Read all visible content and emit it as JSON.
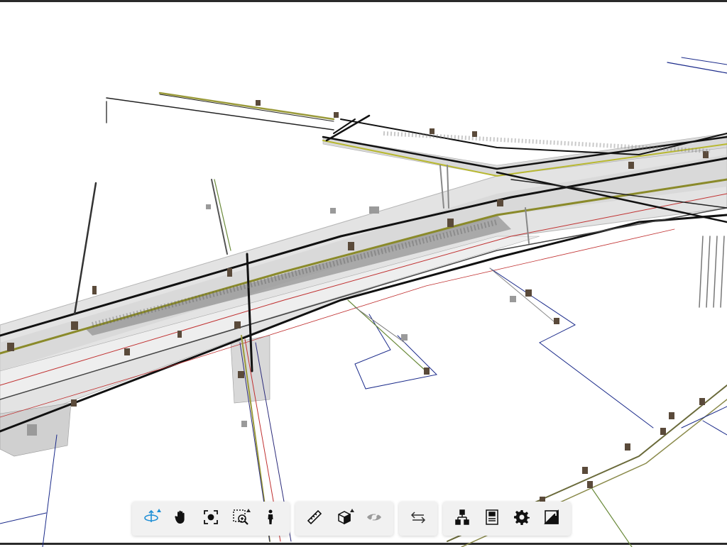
{
  "app": {
    "view": "3D model viewer",
    "accent_color": "#1f8fd6"
  },
  "toolbar": {
    "groups": [
      {
        "name": "navigation",
        "tools": [
          {
            "icon": "orbit-icon",
            "active": true,
            "has_submenu": true
          },
          {
            "icon": "pan-hand-icon",
            "active": false,
            "has_submenu": false
          },
          {
            "icon": "fit-to-view-icon",
            "active": false,
            "has_submenu": false
          },
          {
            "icon": "zoom-window-icon",
            "active": false,
            "has_submenu": true
          },
          {
            "icon": "first-person-icon",
            "active": false,
            "has_submenu": false
          }
        ]
      },
      {
        "name": "tools",
        "tools": [
          {
            "icon": "measure-icon",
            "active": false,
            "has_submenu": false
          },
          {
            "icon": "section-box-icon",
            "active": false,
            "has_submenu": true
          },
          {
            "icon": "explode-icon",
            "active": false,
            "disabled": true,
            "has_submenu": false
          }
        ]
      },
      {
        "name": "sync",
        "tools": [
          {
            "icon": "swap-arrows-icon",
            "active": false,
            "has_submenu": false
          }
        ]
      },
      {
        "name": "panels",
        "tools": [
          {
            "icon": "model-browser-icon",
            "active": false,
            "has_submenu": false
          },
          {
            "icon": "properties-icon",
            "active": false,
            "has_submenu": false
          },
          {
            "icon": "settings-gear-icon",
            "active": false,
            "has_submenu": false
          },
          {
            "icon": "fullscreen-icon",
            "active": false,
            "has_submenu": false
          }
        ]
      }
    ]
  }
}
